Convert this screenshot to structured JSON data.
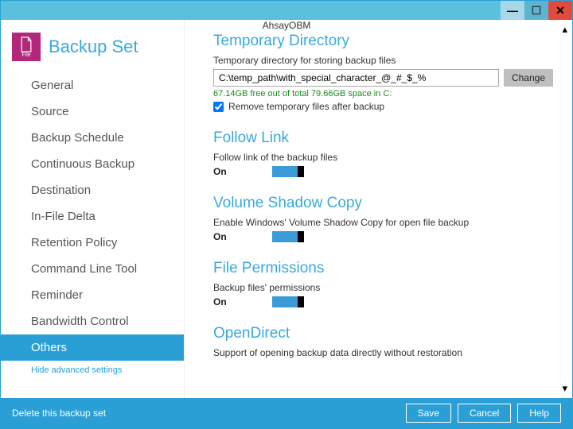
{
  "window": {
    "title": "AhsayOBM"
  },
  "sidebar": {
    "header_title": "Backup Set",
    "icon_label": "File",
    "items": [
      "General",
      "Source",
      "Backup Schedule",
      "Continuous Backup",
      "Destination",
      "In-File Delta",
      "Retention Policy",
      "Command Line Tool",
      "Reminder",
      "Bandwidth Control",
      "Others"
    ],
    "active_index": 10,
    "hide_advanced": "Hide advanced settings"
  },
  "content": {
    "temp_dir": {
      "title": "Temporary Directory",
      "subtitle": "Temporary directory for storing backup files",
      "path": "C:\\temp_path\\with_special_character_@_#_$_%",
      "change_btn": "Change",
      "free_space": "67.14GB free out of total 79.66GB space in C:",
      "remove_temp_label": "Remove temporary files after backup",
      "remove_temp_checked": true
    },
    "follow_link": {
      "title": "Follow Link",
      "subtitle": "Follow link of the backup files",
      "state": "On"
    },
    "vss": {
      "title": "Volume Shadow Copy",
      "subtitle": "Enable Windows' Volume Shadow Copy for open file backup",
      "state": "On"
    },
    "file_perm": {
      "title": "File Permissions",
      "subtitle": "Backup files' permissions",
      "state": "On"
    },
    "open_direct": {
      "title": "OpenDirect",
      "subtitle": "Support of opening backup data directly without restoration"
    }
  },
  "footer": {
    "delete": "Delete this backup set",
    "save": "Save",
    "cancel": "Cancel",
    "help": "Help"
  }
}
